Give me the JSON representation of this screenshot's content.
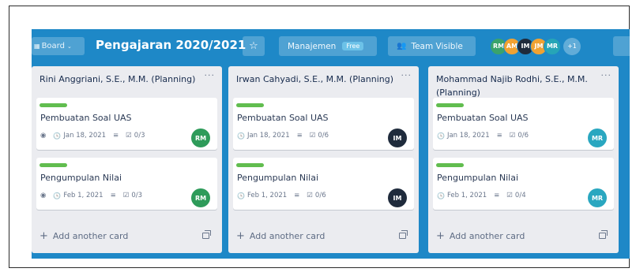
{
  "board": {
    "menu_label": "Board",
    "menu_icon": "board-icon",
    "title": "Pengajaran 2020/2021",
    "team_label": "Manajemen",
    "team_badge": "Free",
    "visibility_label": "Team Visible",
    "members": [
      {
        "initials": "RM",
        "color": "#3aa36c"
      },
      {
        "initials": "AM",
        "color": "#f0a232"
      },
      {
        "initials": "IM",
        "color": "#1f2b3c"
      },
      {
        "initials": "JM",
        "color": "#f0a232"
      },
      {
        "initials": "MR",
        "color": "#26a5b7"
      }
    ],
    "more_members": "+1"
  },
  "lists": [
    {
      "title": "Rini Anggriani, S.E., M.M. (Planning)",
      "cards": [
        {
          "title": "Pembuatan Soal UAS",
          "watch": true,
          "date": "Jan 18, 2021",
          "checklist": "0/3",
          "member": "RM",
          "member_color": "#2e9b5a"
        },
        {
          "title": "Pengumpulan Nilai",
          "watch": true,
          "date": "Feb 1, 2021",
          "checklist": "0/3",
          "member": "RM",
          "member_color": "#2e9b5a"
        }
      ],
      "add_label": "Add another card"
    },
    {
      "title": "Irwan Cahyadi, S.E., M.M. (Planning)",
      "cards": [
        {
          "title": "Pembuatan Soal UAS",
          "watch": false,
          "date": "Jan 18, 2021",
          "checklist": "0/6",
          "member": "IM",
          "member_color": "#1f2b3c"
        },
        {
          "title": "Pengumpulan Nilai",
          "watch": false,
          "date": "Feb 1, 2021",
          "checklist": "0/6",
          "member": "IM",
          "member_color": "#1f2b3c"
        }
      ],
      "add_label": "Add another card"
    },
    {
      "title": "Mohammad Najib Rodhi, S.E., M.M. (Planning)",
      "cards": [
        {
          "title": "Pembuatan Soal UAS",
          "watch": false,
          "date": "Jan 18, 2021",
          "checklist": "0/6",
          "member": "MR",
          "member_color": "#2aa7c0"
        },
        {
          "title": "Pengumpulan Nilai",
          "watch": false,
          "date": "Feb 1, 2021",
          "checklist": "0/4",
          "member": "MR",
          "member_color": "#2aa7c0"
        }
      ],
      "add_label": "Add another card"
    }
  ]
}
